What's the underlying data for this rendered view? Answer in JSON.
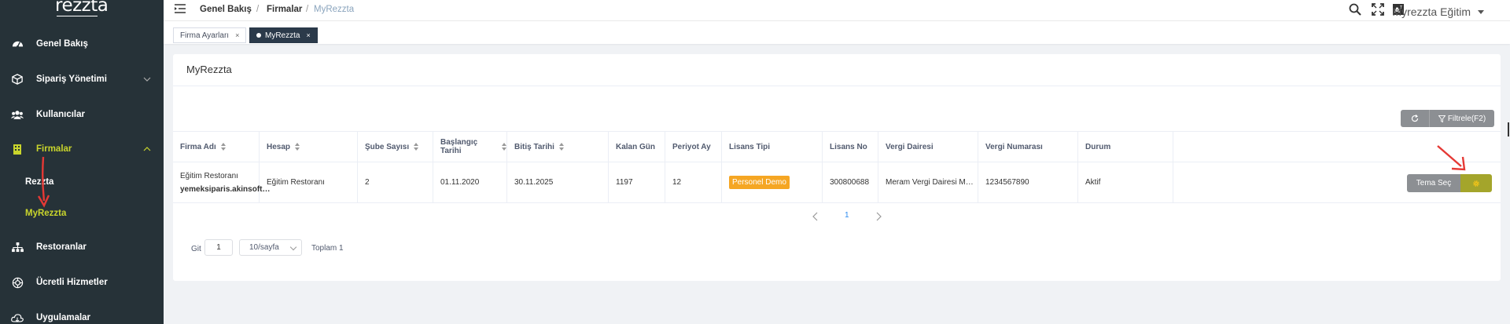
{
  "app": {
    "logo": "rezzta"
  },
  "sidebar": {
    "items": [
      {
        "label": "Genel Bakış",
        "icon": "dashboard-icon"
      },
      {
        "label": "Sipariş Yönetimi",
        "icon": "package-icon"
      },
      {
        "label": "Kullanıcılar",
        "icon": "users-icon"
      },
      {
        "label": "Firmalar",
        "icon": "building-icon"
      },
      {
        "label": "Restoranlar",
        "icon": "sitemap-icon"
      },
      {
        "label": "Ücretli Hizmetler",
        "icon": "services-icon"
      },
      {
        "label": "Uygulamalar",
        "icon": "cloud-icon"
      }
    ],
    "sub_items": [
      {
        "label": "Rezzta"
      },
      {
        "label": "MyRezzta"
      }
    ]
  },
  "header": {
    "breadcrumb": [
      "Genel Bakış",
      "Firmalar",
      "MyRezzta"
    ],
    "separator": "/",
    "user": "Myrezzta Eğitim"
  },
  "tabs": [
    {
      "label": "Firma Ayarları",
      "close": "×"
    },
    {
      "label": "MyRezzta",
      "close": "×"
    }
  ],
  "page": {
    "title": "MyRezzta",
    "filter_label": "Filtrele(F2)"
  },
  "table": {
    "columns": [
      "Firma Adı",
      "Hesap",
      "Şube Sayısı",
      "Başlangıç Tarihi",
      "Bitiş Tarihi",
      "Kalan Gün",
      "Periyot Ay",
      "Lisans Tipi",
      "Lisans No",
      "Vergi Dairesi",
      "Vergi Numarası",
      "Durum"
    ],
    "rows": [
      {
        "firma_adi": "Eğitim Restoranı",
        "firma_sub": "yemeksiparis.akinsoft…",
        "hesap": "Eğitim Restoranı",
        "sube_sayisi": "2",
        "baslangic": "01.11.2020",
        "bitis": "30.11.2025",
        "kalan_gun": "1197",
        "periyot_ay": "12",
        "lisans_tipi": "Personel Demo",
        "lisans_no": "300800688",
        "vergi_dairesi": "Meram Vergi Dairesi M…",
        "vergi_no": "1234567890",
        "durum": "Aktif",
        "theme_button": "Tema Seç"
      }
    ]
  },
  "pagination": {
    "current_page": "1",
    "goto_label": "Git",
    "goto_value": "1",
    "page_size": "10/sayfa",
    "total": "Toplam 1"
  },
  "colors": {
    "sidebar_bg": "#263238",
    "active_accent": "#c9d52c",
    "badge": "#f5a623",
    "settings_button": "#a4a52b",
    "annotation_arrow": "#e53935"
  }
}
